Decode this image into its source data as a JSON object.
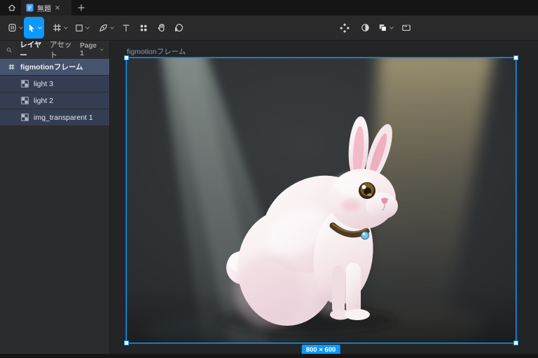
{
  "window": {
    "tab_title": "無題",
    "icons": {
      "home": "home-icon",
      "file": "design-file-icon",
      "close": "close-icon",
      "new_tab": "plus-icon"
    }
  },
  "toolbar": {
    "tools": [
      {
        "name": "main-menu",
        "icon": "figma-menu-icon",
        "has_dropdown": true
      },
      {
        "name": "move-tool",
        "icon": "cursor-icon",
        "selected": true,
        "has_dropdown": true
      },
      {
        "name": "frame-tool",
        "icon": "frame-hash-icon",
        "has_dropdown": true
      },
      {
        "name": "shape-tool",
        "icon": "rectangle-icon",
        "has_dropdown": true
      },
      {
        "name": "pen-tool",
        "icon": "pen-icon",
        "has_dropdown": true
      },
      {
        "name": "text-tool",
        "icon": "text-T-icon"
      },
      {
        "name": "actions",
        "icon": "apps-grid-icon"
      },
      {
        "name": "hand-tool",
        "icon": "hand-icon"
      },
      {
        "name": "comment-tool",
        "icon": "comment-bubble-icon"
      }
    ],
    "right_tools": [
      {
        "name": "component",
        "icon": "component-diamonds-icon"
      },
      {
        "name": "mask",
        "icon": "mask-half-circle-icon"
      },
      {
        "name": "boolean",
        "icon": "boolean-squares-icon",
        "has_dropdown": true
      },
      {
        "name": "dev-mode",
        "icon": "dev-mode-brackets-icon"
      }
    ]
  },
  "sidebar": {
    "search_icon": "search-icon",
    "tabs": [
      {
        "label": "レイヤー",
        "active": true
      },
      {
        "label": "アセット",
        "active": false
      }
    ],
    "page_selector": {
      "label": "Page 1"
    },
    "layers": [
      {
        "label": "figmotionフレーム",
        "type": "frame",
        "selected": true
      },
      {
        "label": "light 3",
        "type": "image"
      },
      {
        "label": "light 2",
        "type": "image"
      },
      {
        "label": "img_transparent 1",
        "type": "image"
      }
    ]
  },
  "canvas": {
    "frame_label": "figmotionフレーム",
    "selection_size": "800 × 600",
    "scene_description": "white rabbit sitting under two spotlights on dark stage"
  },
  "colors": {
    "accent_blue": "#0d99ff",
    "selected_row": "#46536d",
    "child_row": "#353d53",
    "panel_bg": "#2b2c2e",
    "canvas_bg": "#232426",
    "tabbar_bg": "#151515",
    "beam_left": "#aebbb4",
    "beam_right": "#d9c794"
  }
}
